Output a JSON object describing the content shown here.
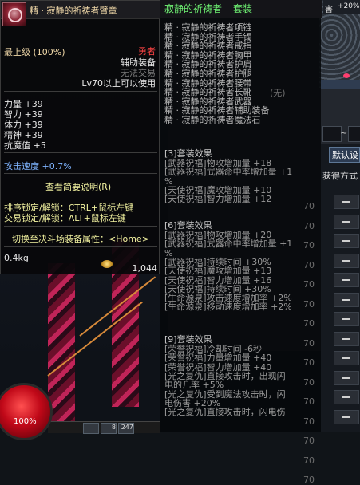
{
  "item_tooltip": {
    "name": "精 · 寂静的祈祷者臂章",
    "grade": "最上级 (100%)",
    "role": "勇者",
    "type": "辅助装备",
    "trade": "无法交易",
    "level_req": "Lv70以上可以使用",
    "stats": [
      {
        "label": "力量",
        "value": "+39"
      },
      {
        "label": "智力",
        "value": "+39"
      },
      {
        "label": "体力",
        "value": "+39"
      },
      {
        "label": "精神",
        "value": "+39"
      },
      {
        "label": "抗魔值",
        "value": "+5"
      }
    ],
    "attack_speed": "攻击速度 +0.7%",
    "brief_link": "查看简要说明(R)",
    "lock_sort": "排序锁定/解锁：CTRL+鼠标左键",
    "lock_trade": "交易锁定/解锁：ALT+鼠标左键",
    "switch_attr": "切换至决斗场装备属性：<Home>",
    "weight": "0.4kg",
    "price": "1,044"
  },
  "set_tooltip": {
    "title": "寂静的祈祷者",
    "title_suffix": "套装",
    "pieces": [
      "精 · 寂静的祈祷者项链",
      "精 · 寂静的祈祷者手镯",
      "精 · 寂静的祈祷者戒指",
      "精 · 寂静的祈祷者胸甲",
      "精 · 寂静的祈祷者护肩",
      "精 · 寂静的祈祷者护腿",
      "精 · 寂静的祈祷者腰带",
      "精 · 寂静的祈祷者长靴",
      "精 · 寂静的祈祷者武器",
      "精 · 寂静的祈祷者辅助装备",
      "精 · 寂静的祈祷者魔法石"
    ],
    "set3": {
      "header": "[3]套装效果",
      "lines": [
        "[武器祝福]物攻增加量 +18",
        "[武器祝福]武器命中率增加量 +1",
        "%",
        "[天使祝福]魔攻增加量 +10",
        "[天使祝福]智力增加量 +12"
      ]
    },
    "set6": {
      "header": "[6]套装效果",
      "lines": [
        "[武器祝福]物攻增加量 +20",
        "[武器祝福]武器命中率增加量 +1",
        "%",
        "[武器祝福]持续时间 +30%",
        "[天使祝福]魔攻增加量 +13",
        "[天使祝福]智力增加量 +16",
        "[天使祝福]持续时间 +30%",
        "[生命源泉]攻击速度增加率 +2%",
        "[生命源泉]移动速度增加率 +2%"
      ]
    },
    "set9": {
      "header": "[9]套装效果",
      "lines": [
        "[荣誉祝福]冷却时间 -6秒",
        "[荣誉祝福]力量增加量 +40",
        "[荣誉祝福]智力增加量 +40",
        "[光之复仇]直接攻击时，出现闪",
        "电的几率 +5%",
        "[光之复仇]受到魔法攻击时，闪",
        "电伤害 +20%",
        "[光之复仇]直接攻击时，闪电伤"
      ]
    }
  },
  "background_ui": {
    "top_right_char": "害",
    "top_right_pct": "+20%",
    "reset_button": "默认设",
    "obtain_label": "获得方式",
    "tilde": "~",
    "faded_values": [
      "70",
      "70",
      "70",
      "70",
      "70",
      "70",
      "70",
      "70",
      "70",
      "70",
      "70",
      "70",
      "70",
      "70",
      "70"
    ],
    "faded_partial": "(无)",
    "hud_percent": "100%",
    "hud_slot_labels": [
      "",
      "8",
      "247"
    ]
  },
  "colors": {
    "gold_name": "#f0d8a8",
    "role_red": "#ff4545",
    "stat_white": "#e8e8e8",
    "blue_attr": "#7fb4ff",
    "link_yellow": "#f2f2a0",
    "green_set": "#6ef072",
    "orange_hint": "#f0b040"
  },
  "icons": [
    "armband-icon",
    "gold-coin-icon",
    "hp-orb-icon"
  ]
}
